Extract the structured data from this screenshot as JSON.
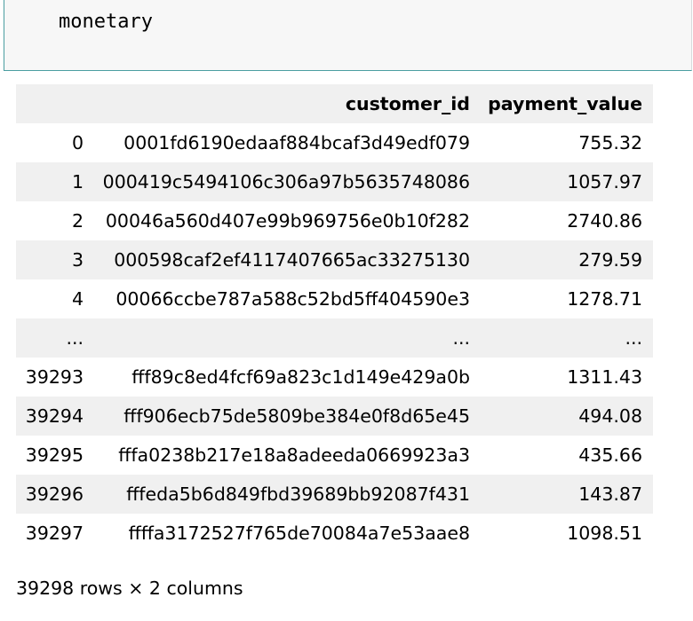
{
  "input_cell": {
    "code": "monetary"
  },
  "dataframe": {
    "columns": {
      "index": "",
      "customer_id": "customer_id",
      "payment_value": "payment_value"
    },
    "rows": [
      {
        "index": "0",
        "customer_id": "0001fd6190edaaf884bcaf3d49edf079",
        "payment_value": "755.32"
      },
      {
        "index": "1",
        "customer_id": "000419c5494106c306a97b5635748086",
        "payment_value": "1057.97"
      },
      {
        "index": "2",
        "customer_id": "00046a560d407e99b969756e0b10f282",
        "payment_value": "2740.86"
      },
      {
        "index": "3",
        "customer_id": "000598caf2ef4117407665ac33275130",
        "payment_value": "279.59"
      },
      {
        "index": "4",
        "customer_id": "00066ccbe787a588c52bd5ff404590e3",
        "payment_value": "1278.71"
      },
      {
        "index": "...",
        "customer_id": "...",
        "payment_value": "..."
      },
      {
        "index": "39293",
        "customer_id": "fff89c8ed4fcf69a823c1d149e429a0b",
        "payment_value": "1311.43"
      },
      {
        "index": "39294",
        "customer_id": "fff906ecb75de5809be384e0f8d65e45",
        "payment_value": "494.08"
      },
      {
        "index": "39295",
        "customer_id": "fffa0238b217e18a8adeeda0669923a3",
        "payment_value": "435.66"
      },
      {
        "index": "39296",
        "customer_id": "fffeda5b6d849fbd39689bb92087f431",
        "payment_value": "143.87"
      },
      {
        "index": "39297",
        "customer_id": "ffffa3172527f765de70084a7e53aae8",
        "payment_value": "1098.51"
      }
    ],
    "shape_summary": "39298 rows × 2 columns"
  },
  "colors": {
    "cell_border_accent": "#4a9ea1",
    "stripe": "#f0f0f0",
    "code_background": "#f7f7f7"
  }
}
